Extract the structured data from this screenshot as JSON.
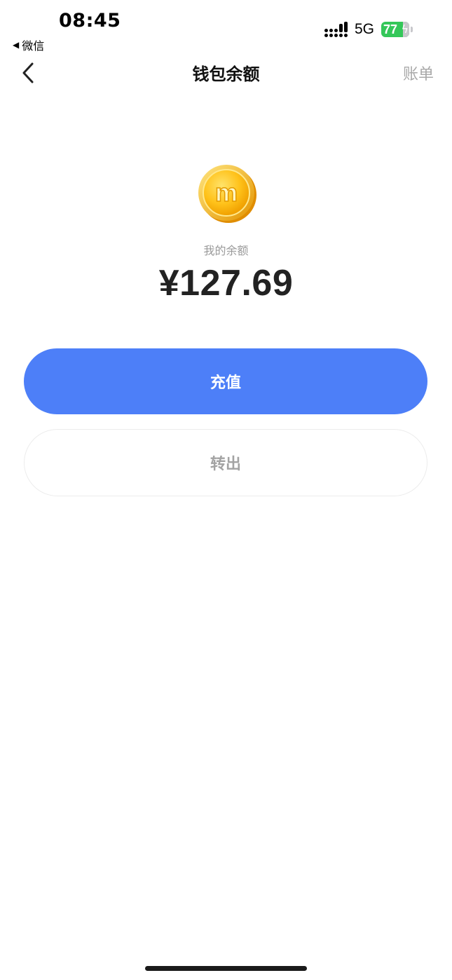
{
  "status_bar": {
    "time": "08:45",
    "back_app": "微信",
    "network": "5G",
    "battery_level": "77",
    "battery_fraction": 0.77,
    "battery_color": "#34c759"
  },
  "nav": {
    "title": "钱包余额",
    "right_action": "账单",
    "back_icon": "chevron-left-icon"
  },
  "balance": {
    "label": "我的余额",
    "amount": "¥127.69",
    "coin_icon": "gold-coin-m-icon",
    "coin_letter": "m"
  },
  "actions": {
    "recharge_label": "充值",
    "withdraw_label": "转出",
    "accent_color": "#4d7ff8"
  }
}
